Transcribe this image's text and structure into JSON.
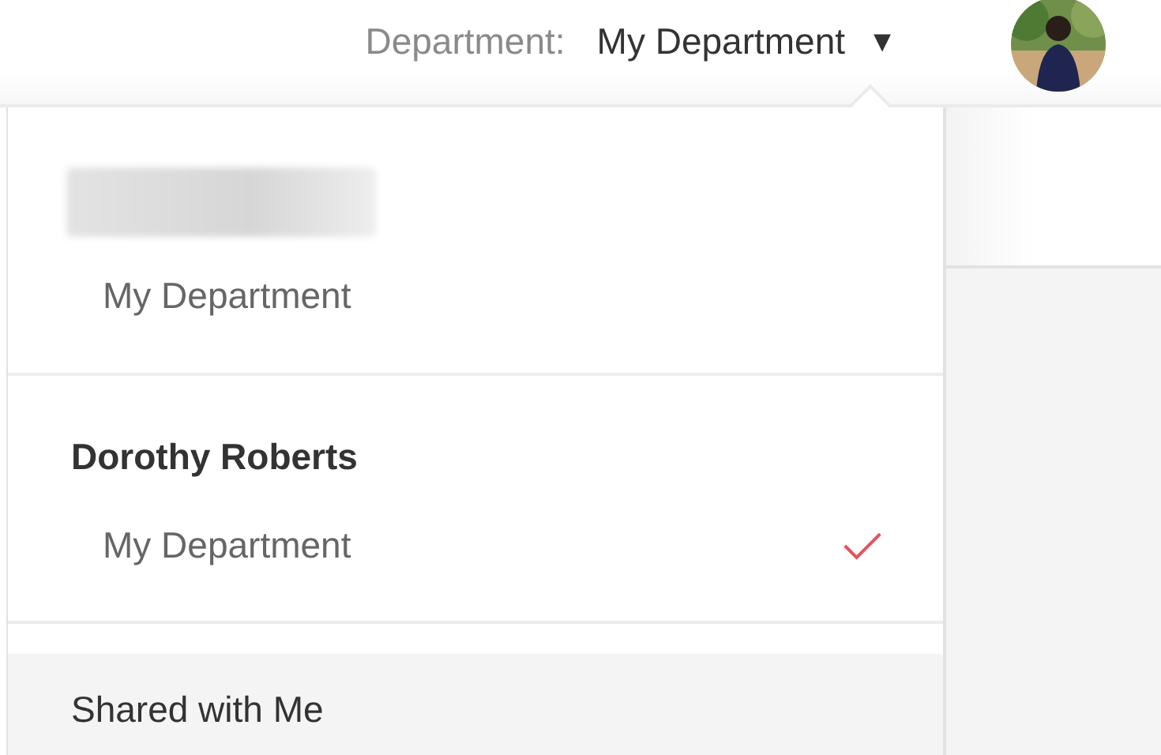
{
  "header": {
    "label": "Department:",
    "value": "My Department",
    "caret": "▾"
  },
  "dropdown": {
    "groups": [
      {
        "heading_redacted": true,
        "items": [
          {
            "label": "My Department",
            "selected": false,
            "hovered": false
          }
        ]
      },
      {
        "heading": "Dorothy Roberts",
        "items": [
          {
            "label": "My Department",
            "selected": true,
            "hovered": false
          }
        ]
      },
      {
        "items": [
          {
            "label": "Shared with Me",
            "selected": false,
            "hovered": true
          }
        ]
      }
    ]
  }
}
